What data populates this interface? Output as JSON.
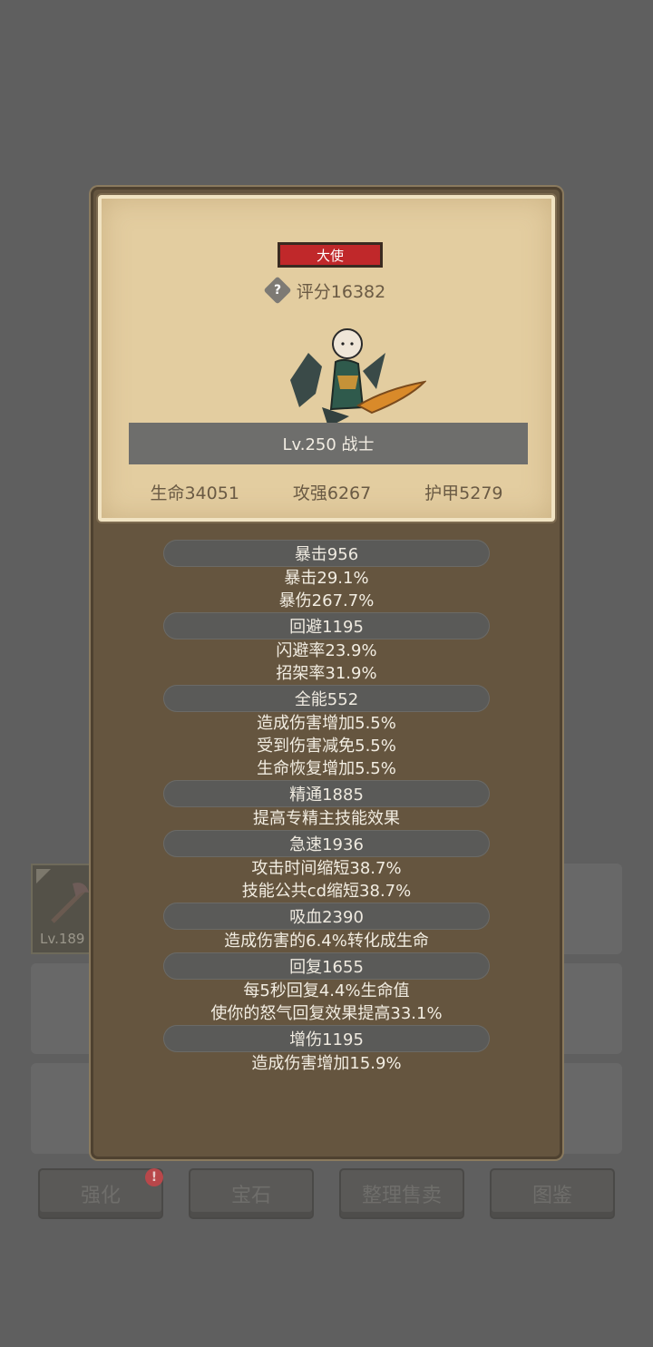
{
  "background": {
    "equip_slot_level": "Lv.189",
    "bottom_buttons": [
      {
        "label": "强化",
        "alert": "!"
      },
      {
        "label": "宝石"
      },
      {
        "label": "整理售卖"
      },
      {
        "label": "图鉴"
      }
    ]
  },
  "panel": {
    "rank_badge": "大使",
    "score": "评分16382",
    "help_icon": "?",
    "hero": {
      "level_text": "Lv.250 战士",
      "hp": "生命34051",
      "attack": "攻强6267",
      "armor": "护甲5279"
    },
    "attributes": [
      {
        "title": "暴击956",
        "lines": [
          "暴击29.1%",
          "暴伤267.7%"
        ]
      },
      {
        "title": "回避1195",
        "lines": [
          "闪避率23.9%",
          "招架率31.9%"
        ]
      },
      {
        "title": "全能552",
        "lines": [
          "造成伤害增加5.5%",
          "受到伤害减免5.5%",
          "生命恢复增加5.5%"
        ]
      },
      {
        "title": "精通1885",
        "lines": [
          "提高专精主技能效果"
        ]
      },
      {
        "title": "急速1936",
        "lines": [
          "攻击时间缩短38.7%",
          "技能公共cd缩短38.7%"
        ]
      },
      {
        "title": "吸血2390",
        "lines": [
          "造成伤害的6.4%转化成生命"
        ]
      },
      {
        "title": "回复1655",
        "lines": [
          "每5秒回复4.4%生命值",
          "使你的怒气回复效果提高33.1%"
        ]
      },
      {
        "title": "增伤1195",
        "lines": [
          "造成伤害增加15.9%"
        ]
      }
    ]
  },
  "colors": {
    "rank_badge": "#c0282a",
    "parchment": "#e3cda0",
    "panel": "#65553f"
  }
}
